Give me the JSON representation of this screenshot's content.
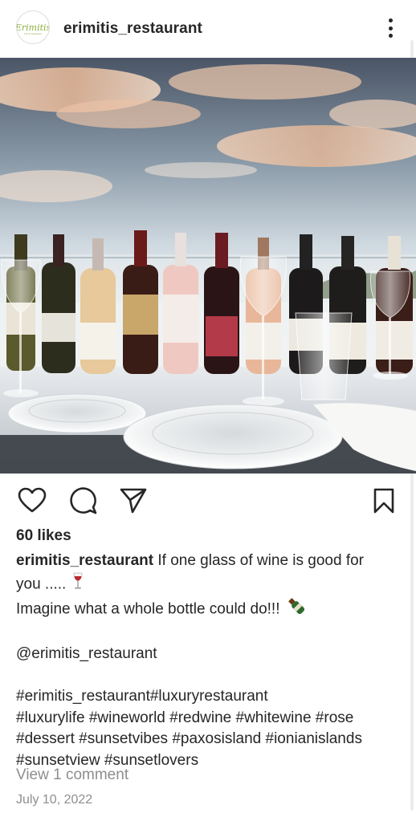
{
  "post": {
    "username": "erimitis_restaurant",
    "avatar_logo_text": "Erimitis",
    "avatar_logo_subtext": "bar & restaurant",
    "likes": "60 likes",
    "caption": {
      "line1": "If one glass of wine is good for",
      "line2": "you .....",
      "line3": "Imagine what a whole bottle could do!!!",
      "mention": "@erimitis_restaurant",
      "hashtags": [
        "#erimitis_restaurant#luxuryrestaurant",
        "#luxurylife #wineworld #redwine #whitewine #rose",
        "#dessert #sunsetvibes #paxosisland #ionianislands",
        "#sunsetview #sunsetlovers"
      ]
    },
    "view_comments": "View 1 comment",
    "date": "July 10, 2022"
  },
  "icons": {
    "more": "more-options-icon",
    "like": "heart-icon",
    "comment": "comment-icon",
    "share": "share-icon",
    "save": "bookmark-icon",
    "emoji_glass": "wine-glass-emoji",
    "emoji_bottle": "bottle-emoji"
  },
  "colors": {
    "text": "#262626",
    "muted": "#8e8e8e",
    "brand_green": "#8fae3f"
  }
}
